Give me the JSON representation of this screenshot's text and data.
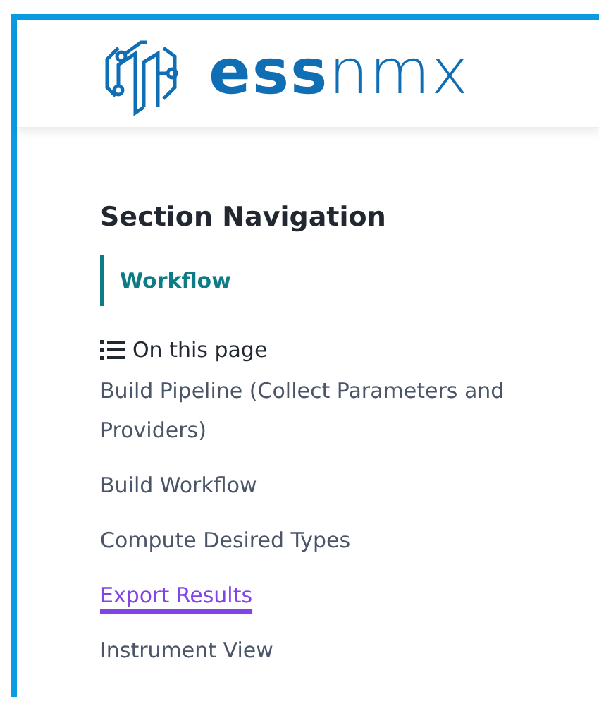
{
  "header": {
    "logo_text": "**ess**nmx"
  },
  "section_navigation": {
    "title": "Section Navigation",
    "items": [
      {
        "label": "Workflow",
        "selected": true
      }
    ]
  },
  "on_this_page": {
    "title": "On this page",
    "links": [
      {
        "label": "Build Pipeline (Collect Parameters and Providers)",
        "hovered": false
      },
      {
        "label": "Build Workflow",
        "hovered": false
      },
      {
        "label": "Compute Desired Types",
        "hovered": false
      },
      {
        "label": "Export Results",
        "hovered": true
      },
      {
        "label": "Instrument View",
        "hovered": false
      }
    ]
  }
}
